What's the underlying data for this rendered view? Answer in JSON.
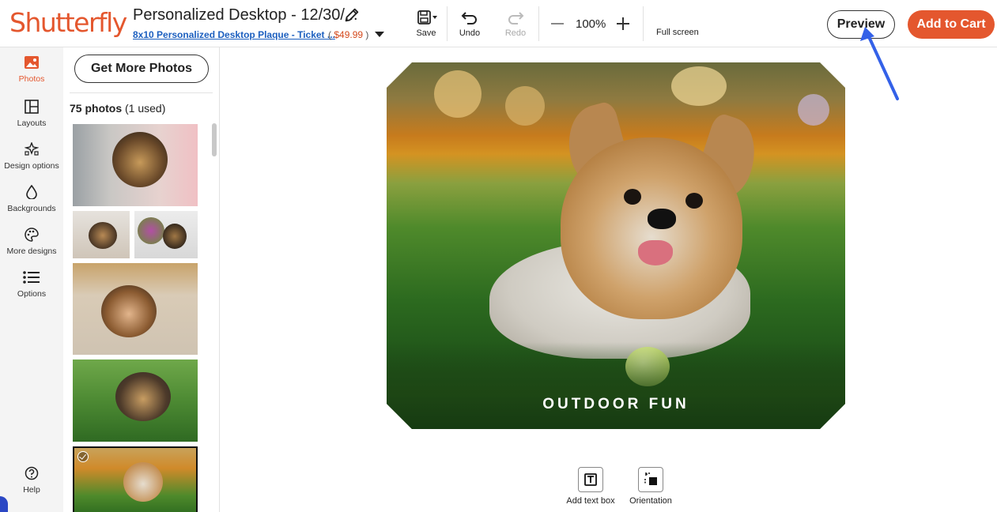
{
  "brand": {
    "logo": "Shutterfly",
    "accent": "#e4572e"
  },
  "project": {
    "title": "Personalized Desktop - 12/30/...",
    "product_link": "8x10 Personalized Desktop Plaque - Ticket ...",
    "price": "$49.99",
    "price_open": "(",
    "price_close": ")"
  },
  "toolbar": {
    "save_label": "Save",
    "undo_label": "Undo",
    "redo_label": "Redo",
    "zoom": "100%",
    "fullscreen_label": "Full screen",
    "preview_label": "Preview",
    "cart_label": "Add to Cart"
  },
  "rail": {
    "items": [
      {
        "label": "Photos",
        "icon": "photos-icon",
        "active": true
      },
      {
        "label": "Layouts",
        "icon": "layouts-icon"
      },
      {
        "label": "Design options",
        "icon": "design-options-icon"
      },
      {
        "label": "Backgrounds",
        "icon": "backgrounds-icon"
      },
      {
        "label": "More designs",
        "icon": "palette-icon"
      },
      {
        "label": "Options",
        "icon": "list-icon"
      }
    ],
    "help_label": "Help"
  },
  "photos_panel": {
    "get_more_label": "Get More Photos",
    "count_bold": "75 photos",
    "count_rest": " (1 used)"
  },
  "canvas": {
    "plaque_text": "OUTDOOR FUN",
    "tools": [
      {
        "label": "Add text box",
        "icon": "text-box-icon"
      },
      {
        "label": "Orientation",
        "icon": "orientation-icon"
      }
    ]
  }
}
